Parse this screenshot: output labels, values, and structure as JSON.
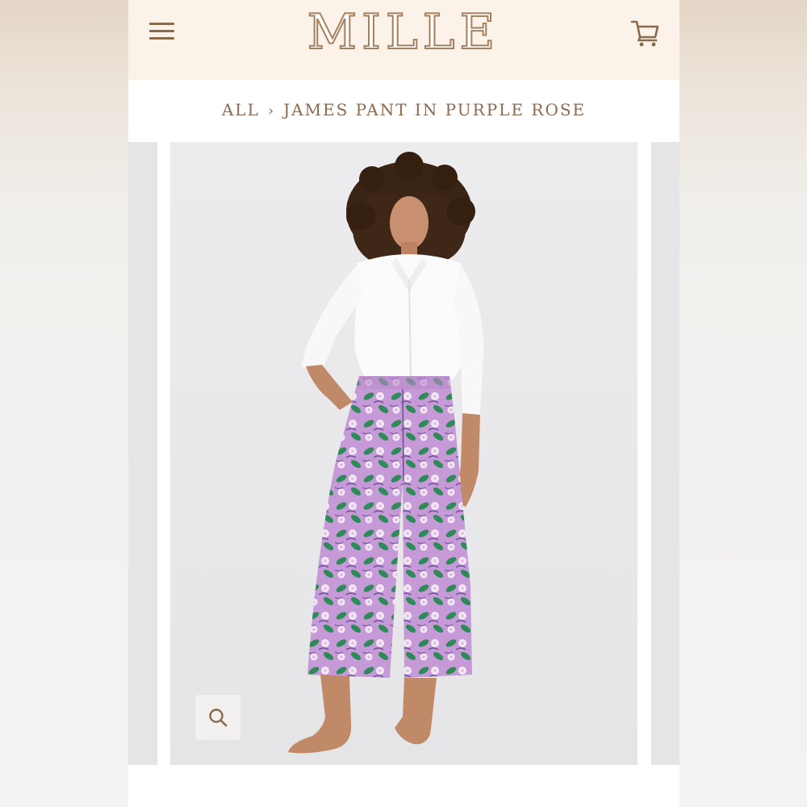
{
  "brand": {
    "name": "MILLE"
  },
  "header": {
    "menu_icon": "hamburger-menu-icon",
    "cart_icon": "shopping-cart-icon"
  },
  "breadcrumb": {
    "items": [
      "ALL",
      "JAMES PANT IN PURPLE ROSE"
    ],
    "separator": "›"
  },
  "gallery": {
    "zoom_icon": "search-icon"
  },
  "colors": {
    "header_bg": "#fbf3ea",
    "brand_brown": "#a67f5c",
    "text_brown": "#8b6a4f",
    "pant_purple": "#c79ad8",
    "pant_green": "#2f8a5a"
  }
}
